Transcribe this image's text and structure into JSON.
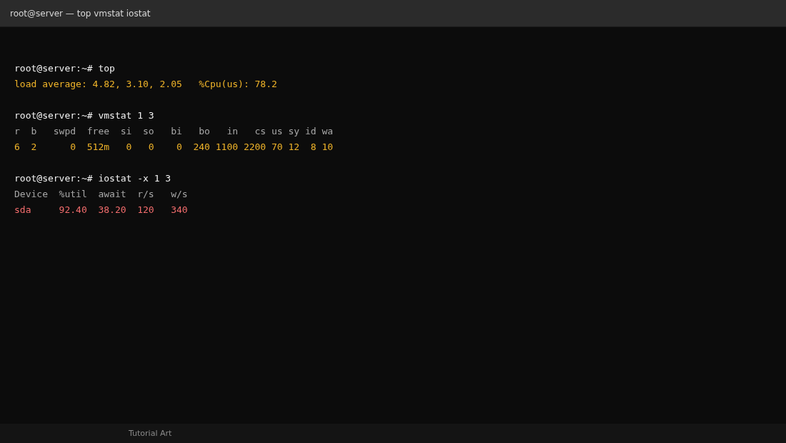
{
  "window": {
    "title": "root@server — top vmstat iostat"
  },
  "terminal": {
    "lines": [
      {
        "kind": "prompt",
        "text": "root@server:~# top"
      },
      {
        "kind": "value",
        "text": "load average: 4.82, 3.10, 2.05   %Cpu(us): 78.2"
      },
      {
        "kind": "blank"
      },
      {
        "kind": "prompt",
        "text": "root@server:~# vmstat 1 3"
      },
      {
        "kind": "header",
        "text": "r  b   swpd  free  si  so   bi   bo   in   cs us sy id wa"
      },
      {
        "kind": "value",
        "text": "6  2      0  512m   0   0    0  240 1100 2200 70 12  8 10"
      },
      {
        "kind": "blank"
      },
      {
        "kind": "prompt",
        "text": "root@server:~# iostat -x 1 3"
      },
      {
        "kind": "header",
        "text": "Device  %util  await  r/s   w/s"
      },
      {
        "kind": "alert",
        "text": "sda     92.40  38.20  120   340"
      }
    ]
  },
  "status_bar": {
    "text": "Tutorial Art"
  }
}
